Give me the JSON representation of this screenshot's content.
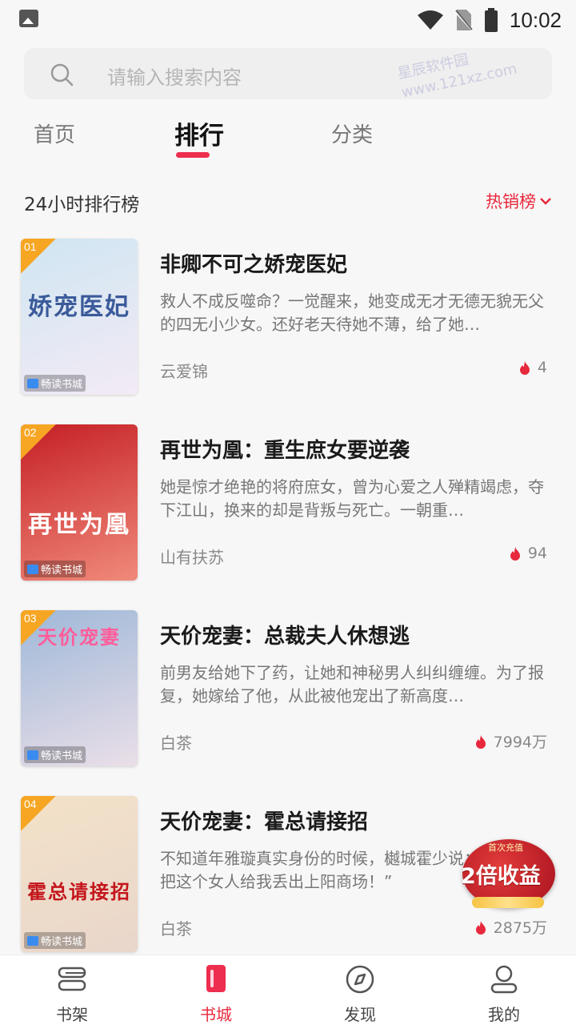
{
  "status_bar": {
    "time": "10:02"
  },
  "search": {
    "placeholder": "请输入搜索内容"
  },
  "watermark": {
    "line1": "星辰软件园",
    "line2": "www.121xz.com"
  },
  "tabs": [
    {
      "label": "首页",
      "active": false
    },
    {
      "label": "排行",
      "active": true
    },
    {
      "label": "分类",
      "active": false
    }
  ],
  "section": {
    "title": "24小时排行榜",
    "filter_label": "热销榜"
  },
  "books": [
    {
      "rank": "01",
      "title": "非卿不可之娇宠医妃",
      "cover_title": "娇宠医妃",
      "description": "救人不成反噬命？一觉醒来，她变成无才无德无貌无父的四无小少女。还好老天待她不薄，给了她…",
      "author": "云爱锦",
      "heat": "4",
      "publisher": "畅读书城",
      "cover_colors": [
        "#cfe6f2",
        "#f3eaf5"
      ],
      "title_color": "#3a5a9a"
    },
    {
      "rank": "02",
      "title": "再世为凰：重生庶女要逆袭",
      "cover_title": "再世为凰",
      "description": "她是惊才绝艳的将府庶女，曾为心爱之人殚精竭虑，夺下江山，换来的却是背叛与死亡。一朝重…",
      "author": "山有扶苏",
      "heat": "94",
      "publisher": "畅读书城",
      "cover_colors": [
        "#c51f25",
        "#f08a7a"
      ],
      "title_color": "#ffffff"
    },
    {
      "rank": "03",
      "title": "天价宠妻：总裁夫人休想逃",
      "cover_title": "天价宠妻",
      "description": "前男友给她下了药，让她和神秘男人纠纠缠缠。为了报复，她嫁给了他，从此被他宠出了新高度…",
      "author": "白茶",
      "heat": "7994万",
      "publisher": "畅读书城",
      "cover_colors": [
        "#9fb8d8",
        "#eadfe8"
      ],
      "title_color": "#ff5c9a"
    },
    {
      "rank": "04",
      "title": "天价宠妻：霍总请接招",
      "cover_title": "霍总请接招",
      "description": "不知道年雅璇真实身份的时候，樾城霍少说：“来人！把这个女人给我丢出上阳商场！”",
      "author": "白茶",
      "heat": "2875万",
      "publisher": "畅读书城",
      "cover_colors": [
        "#f3e2c8",
        "#e9d6cb"
      ],
      "title_color": "#c4161c"
    }
  ],
  "promo": {
    "top_text": "首次充值",
    "main_text": "2倍收益"
  },
  "bottom_nav": [
    {
      "label": "书架",
      "icon": "bookshelf-icon",
      "active": false
    },
    {
      "label": "书城",
      "icon": "bookstore-icon",
      "active": true
    },
    {
      "label": "发现",
      "icon": "compass-icon",
      "active": false
    },
    {
      "label": "我的",
      "icon": "profile-icon",
      "active": false
    }
  ],
  "colors": {
    "accent": "#e8283c",
    "tab_underline": "#ee2e4f",
    "rank_badge": "#f6a623"
  }
}
